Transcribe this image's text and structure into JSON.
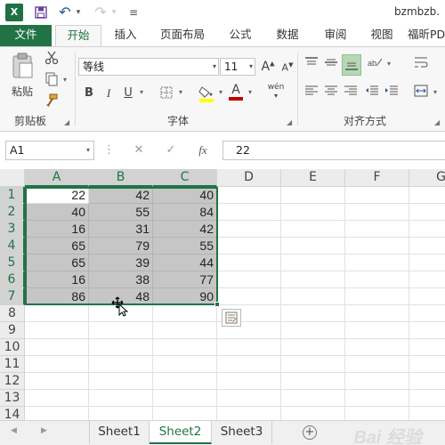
{
  "titlebar": {
    "logo": "X",
    "undo_arrow": "↶",
    "redo_arrow": "↷",
    "menu_glyph": "≡",
    "dropdown_glyph": "▾",
    "window_title": "bzmbzb."
  },
  "ribbon_tabs": [
    "文件",
    "开始",
    "插入",
    "页面布局",
    "公式",
    "数据",
    "审阅",
    "视图",
    "福昕PD"
  ],
  "ribbon": {
    "clipboard": {
      "paste_label": "粘贴",
      "group_label": "剪贴板"
    },
    "font": {
      "font_name": "等线",
      "font_size": "11",
      "grow_glyph": "A",
      "shrink_glyph": "A",
      "bold": "B",
      "italic": "I",
      "underline": "U",
      "font_color_glyph": "A",
      "phonetic_glyph": "wén",
      "group_label": "字体",
      "fill_color": "#ffff00",
      "font_color": "#c00000"
    },
    "alignment": {
      "group_label": "对齐方式"
    },
    "launcher_glyph": "◢"
  },
  "formula_bar": {
    "name_box": "A1",
    "dropdown_glyph": "▾",
    "dots_glyph": "⋮",
    "cancel_glyph": "✕",
    "enter_glyph": "✓",
    "fx_label": "fx",
    "value": "22"
  },
  "grid": {
    "columns": [
      "A",
      "B",
      "C",
      "D",
      "E",
      "F",
      "G"
    ],
    "rows": [
      "1",
      "2",
      "3",
      "4",
      "5",
      "6",
      "7",
      "8",
      "9",
      "10",
      "11",
      "12",
      "13",
      "14"
    ],
    "data": [
      [
        "22",
        "42",
        "40"
      ],
      [
        "40",
        "55",
        "84"
      ],
      [
        "16",
        "31",
        "42"
      ],
      [
        "65",
        "79",
        "55"
      ],
      [
        "65",
        "39",
        "44"
      ],
      [
        "16",
        "38",
        "77"
      ],
      [
        "86",
        "48",
        "90"
      ]
    ],
    "selection": "A1:C7",
    "active_cell": "A1"
  },
  "sheets": {
    "nav_prev": "◀",
    "nav_next": "▶",
    "tabs": [
      "Sheet1",
      "Sheet2",
      "Sheet3"
    ],
    "active": "Sheet2",
    "add_glyph": "+"
  },
  "watermark": "Bai 经验",
  "colors": {
    "accent_green": "#217346",
    "selection_fill": "#c6c6c6",
    "header_fill": "#ececec"
  }
}
